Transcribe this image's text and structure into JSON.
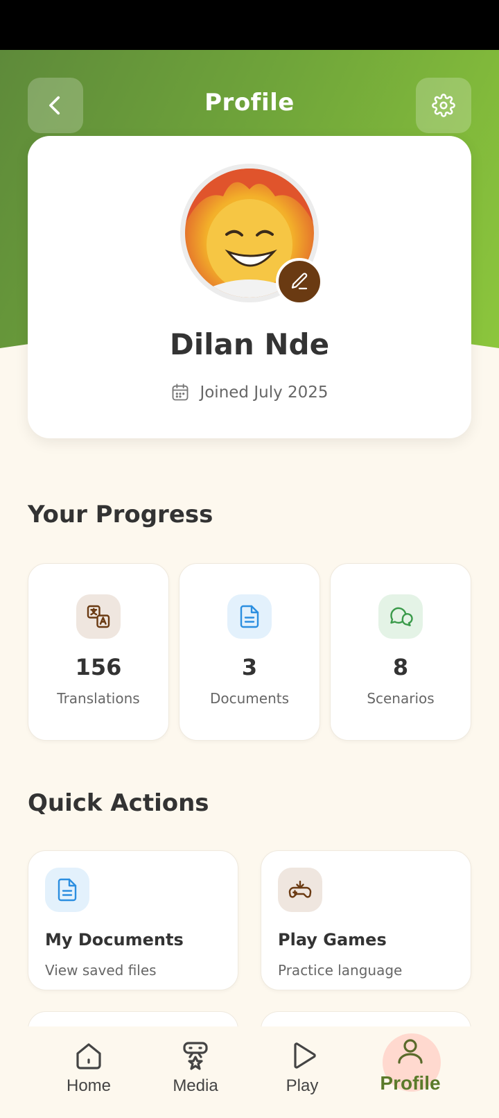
{
  "header": {
    "title": "Profile",
    "back_icon": "chevron-left-icon",
    "settings_icon": "gear-icon"
  },
  "profile": {
    "name": "Dilan Nde",
    "joined": "Joined July 2025",
    "edit_icon": "pencil-icon",
    "calendar_icon": "calendar-icon"
  },
  "progress": {
    "title": "Your Progress",
    "stats": [
      {
        "value": "156",
        "label": "Translations",
        "icon": "translate-icon"
      },
      {
        "value": "3",
        "label": "Documents",
        "icon": "document-icon"
      },
      {
        "value": "8",
        "label": "Scenarios",
        "icon": "chat-bubbles-icon"
      }
    ]
  },
  "quick_actions": {
    "title": "Quick Actions",
    "items": [
      {
        "title": "My Documents",
        "subtitle": "View saved files",
        "icon": "document-icon"
      },
      {
        "title": "Play Games",
        "subtitle": "Practice language",
        "icon": "gamepad-icon"
      }
    ]
  },
  "nav": {
    "items": [
      {
        "label": "Home",
        "icon": "home-icon"
      },
      {
        "label": "Media",
        "icon": "media-icon"
      },
      {
        "label": "Play",
        "icon": "play-icon"
      },
      {
        "label": "Profile",
        "icon": "user-icon",
        "active": true
      }
    ]
  },
  "colors": {
    "accent_green": "#7fb63a",
    "brown": "#6a3a12",
    "blue": "#2b8ee0",
    "green": "#3a9a4a",
    "background": "#fdf8ee"
  }
}
